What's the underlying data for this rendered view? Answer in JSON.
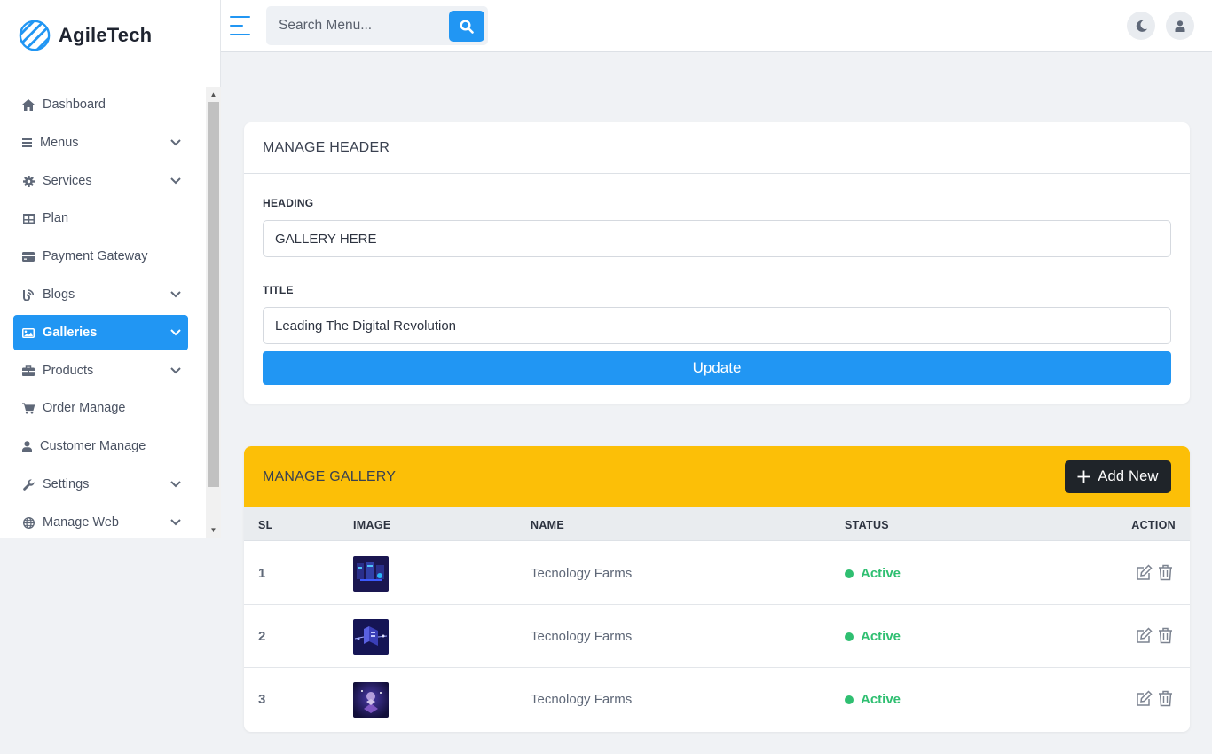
{
  "brand": {
    "name": "AgileTech"
  },
  "sidebar": {
    "items": [
      {
        "label": "Dashboard",
        "icon": "home-icon",
        "has_children": false,
        "active": false
      },
      {
        "label": "Menus",
        "icon": "list-icon",
        "has_children": true,
        "active": false
      },
      {
        "label": "Services",
        "icon": "gear-icon",
        "has_children": true,
        "active": false
      },
      {
        "label": "Plan",
        "icon": "table-icon",
        "has_children": false,
        "active": false
      },
      {
        "label": "Payment Gateway",
        "icon": "credit-card-icon",
        "has_children": false,
        "active": false
      },
      {
        "label": "Blogs",
        "icon": "blog-icon",
        "has_children": true,
        "active": false
      },
      {
        "label": "Galleries",
        "icon": "image-icon",
        "has_children": true,
        "active": true
      },
      {
        "label": "Products",
        "icon": "briefcase-icon",
        "has_children": true,
        "active": false
      },
      {
        "label": "Order Manage",
        "icon": "cart-icon",
        "has_children": false,
        "active": false
      },
      {
        "label": "Customer Manage",
        "icon": "user-icon",
        "has_children": false,
        "active": false
      },
      {
        "label": "Settings",
        "icon": "wrench-icon",
        "has_children": true,
        "active": false
      },
      {
        "label": "Manage Web",
        "icon": "globe-icon",
        "has_children": true,
        "active": false
      }
    ]
  },
  "topbar": {
    "search_placeholder": "Search Menu...",
    "theme_icon": "moon-icon",
    "profile_icon": "user-icon"
  },
  "manage_header": {
    "title": "MANAGE HEADER",
    "heading_label": "HEADING",
    "heading_value": "GALLERY HERE",
    "title_label": "TITLE",
    "title_value": "Leading The Digital Revolution",
    "update_label": "Update"
  },
  "manage_gallery": {
    "title": "MANAGE GALLERY",
    "add_label": "Add New",
    "columns": [
      "SL",
      "IMAGE",
      "NAME",
      "STATUS",
      "ACTION"
    ],
    "rows": [
      {
        "sl": "1",
        "name": "Tecnology Farms",
        "status": "Active"
      },
      {
        "sl": "2",
        "name": "Tecnology Farms",
        "status": "Active"
      },
      {
        "sl": "3",
        "name": "Tecnology Farms",
        "status": "Active"
      }
    ]
  },
  "colors": {
    "primary": "#2196f3",
    "gallery_header": "#fcbf07",
    "status_active": "#2fbf71",
    "dark_button": "#1f2429"
  }
}
